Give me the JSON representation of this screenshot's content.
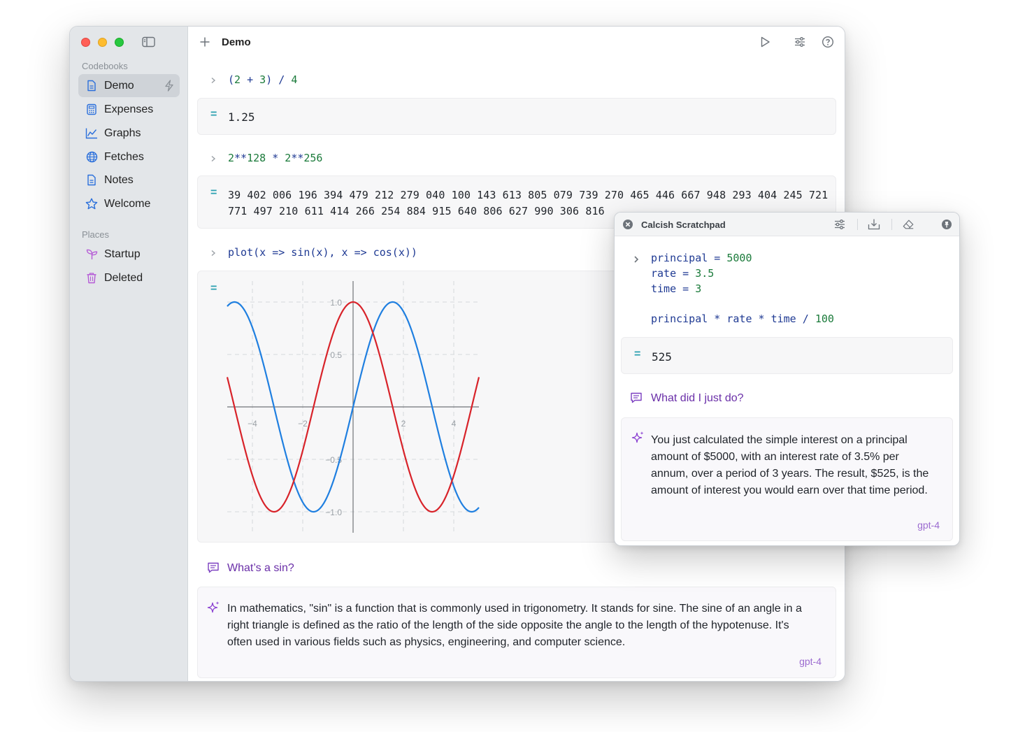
{
  "window": {
    "title": "Demo",
    "sidebar": {
      "codebooks_label": "Codebooks",
      "codebooks": [
        {
          "label": "Demo",
          "icon": "document-icon",
          "active": true
        },
        {
          "label": "Expenses",
          "icon": "calculator-icon"
        },
        {
          "label": "Graphs",
          "icon": "chart-icon"
        },
        {
          "label": "Fetches",
          "icon": "globe-icon"
        },
        {
          "label": "Notes",
          "icon": "document-icon"
        },
        {
          "label": "Welcome",
          "icon": "star-icon"
        }
      ],
      "places_label": "Places",
      "places": [
        {
          "label": "Startup",
          "icon": "sprout-icon"
        },
        {
          "label": "Deleted",
          "icon": "trash-icon"
        }
      ]
    },
    "toolbar_icons": [
      "run-icon",
      "settings-sliders-icon",
      "help-icon"
    ]
  },
  "cells": [
    {
      "input": "(2 + 3) / 4",
      "result": "1.25"
    },
    {
      "input": "2**128 * 2**256",
      "result": "39 402 006 196 394 479 212 279 040 100 143 613 805 079 739 270 465 446 667 948 293 404 245 721 771 497 210 611 414 266 254 884 915 640 806 627 990 306 816"
    },
    {
      "input": "plot(x => sin(x), x => cos(x))",
      "result": "plot"
    }
  ],
  "question": {
    "text": "What’s a sin?"
  },
  "answer": {
    "text": "In mathematics, \"sin\" is a function that is commonly used in trigonometry. It stands for sine. The sine of an angle in a right triangle is defined as the ratio of the length of the side opposite the angle to the length of the hypotenuse. It's often used in various fields such as physics, engineering, and computer science.",
    "model": "gpt-4"
  },
  "chart_data": {
    "type": "line",
    "x_range": [
      -5,
      5
    ],
    "ylim": [
      -1.0,
      1.0
    ],
    "x_ticks": [
      "−4",
      "−2",
      "2",
      "4"
    ],
    "y_ticks": [
      "1.0",
      "0.5",
      "−0.5",
      "−1.0"
    ],
    "series": [
      {
        "function": "sin(x)",
        "color": "#1f7fe0"
      },
      {
        "function": "cos(x)",
        "color": "#d8232a"
      }
    ],
    "grid": true
  },
  "scratchpad": {
    "title": "Calcish Scratchpad",
    "lines": [
      {
        "var": "principal",
        "value": "5000"
      },
      {
        "var": "rate",
        "value": "3.5"
      },
      {
        "var": "time",
        "value": "3"
      }
    ],
    "expression": "principal * rate * time / 100",
    "result": "525",
    "question": "What did I just do?",
    "answer": "You just calculated the simple interest on a principal amount of $5000, with an interest rate of 3.5% per annum, over a period of 3 years. The result, $525, is the amount of interest you would earn over that time period.",
    "model": "gpt-4",
    "icons": [
      "close-icon",
      "settings-sliders-icon",
      "download-icon",
      "eraser-icon",
      "pin-icon"
    ]
  },
  "colors": {
    "accent_purple": "#6a2fa8",
    "code_blue": "#1f3a93",
    "number_green": "#1a7a3a",
    "equals_teal": "#2aa0b0"
  }
}
